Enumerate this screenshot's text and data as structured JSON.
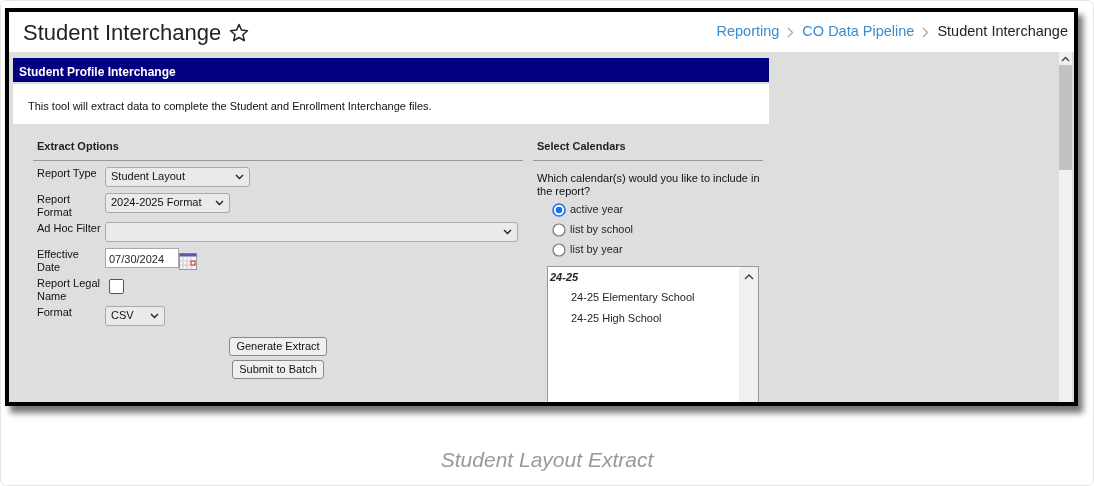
{
  "header": {
    "title": "Student Interchange",
    "favorite": false,
    "breadcrumbs": [
      {
        "label": "Reporting",
        "current": false
      },
      {
        "label": "CO Data Pipeline",
        "current": false
      },
      {
        "label": "Student Interchange",
        "current": true
      }
    ]
  },
  "panel": {
    "title": "Student Profile Interchange",
    "description": "This tool will extract data to complete the Student and Enrollment Interchange files."
  },
  "extract_options": {
    "heading": "Extract Options",
    "fields": [
      {
        "kind": "select",
        "label": "Report Type",
        "value": "Student Layout"
      },
      {
        "kind": "select",
        "label": "Report Format",
        "value": "2024-2025 Format"
      },
      {
        "kind": "select",
        "label": "Ad Hoc Filter"
      },
      {
        "kind": "date",
        "label": "Effective Date",
        "value": "07/30/2024"
      },
      {
        "kind": "checkbox",
        "label": "Report Legal Name",
        "checked": false
      },
      {
        "kind": "select",
        "label": "Format",
        "value": "CSV"
      }
    ],
    "buttons": [
      "Generate Extract",
      "Submit to Batch"
    ]
  },
  "select_calendars": {
    "heading": "Select Calendars",
    "question": "Which calendar(s) would you like to include in the report?",
    "options": [
      {
        "label": "active year",
        "selected": true
      },
      {
        "label": "list by school",
        "selected": false
      },
      {
        "label": "list by year",
        "selected": false
      }
    ],
    "calendar_list": [
      {
        "label": "24-25",
        "children": [
          {
            "label": "24-25 Elementary School"
          },
          {
            "label": "24-25 High School"
          }
        ]
      }
    ]
  },
  "caption": "Student Layout Extract"
}
